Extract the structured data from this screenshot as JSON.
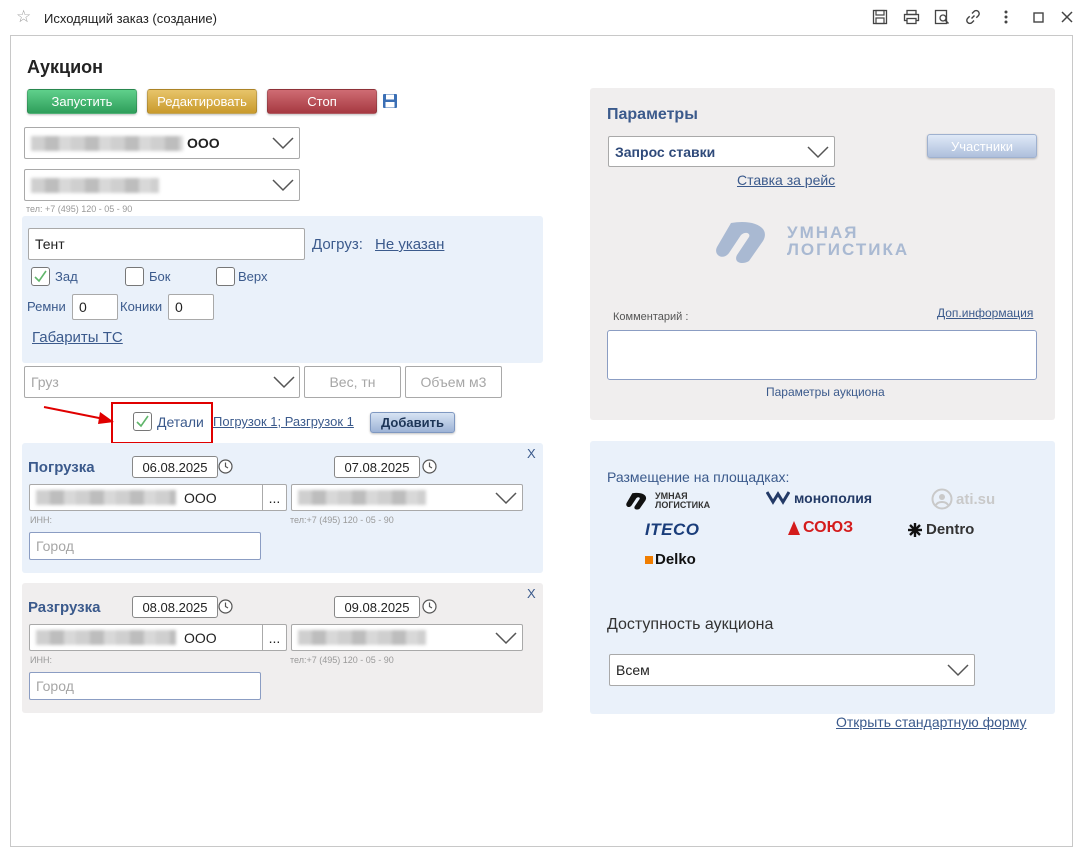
{
  "window": {
    "title": "Исходящий заказ (создание)"
  },
  "form": {
    "title": "Аукцион",
    "buttons": {
      "start": "Запустить",
      "edit": "Редактировать",
      "stop": "Стоп"
    },
    "company_suffix": "ООО",
    "contact_phone": "тел: +7 (495) 120 - 05 - 90",
    "vehicle": {
      "body_type": "Тент",
      "extra_load_label": "Догруз:",
      "extra_load_value": "Не указан",
      "load_options": [
        {
          "label": "Зад",
          "checked": true
        },
        {
          "label": "Бок",
          "checked": false
        },
        {
          "label": "Верх",
          "checked": false
        }
      ],
      "straps_label": "Ремни",
      "straps_value": "0",
      "cones_label": "Коники",
      "cones_value": "0",
      "dimensions_link": "Габариты ТС"
    },
    "cargo": {
      "placeholder": "Груз",
      "weight_placeholder": "Вес, тн",
      "volume_placeholder": "Объем м3"
    },
    "details": {
      "label": "Детали",
      "checked": true,
      "points_link": "Погрузок 1; Разгрузок 1",
      "add_button": "Добавить"
    },
    "loading": {
      "title": "Погрузка",
      "date_from": "06.08.2025",
      "date_to": "07.08.2025",
      "company_suffix": "ООО",
      "select_button": "...",
      "inn_label": "ИНН:",
      "phone": "тел:+7 (495) 120 - 05 - 90",
      "city_placeholder": "Город",
      "close": "X"
    },
    "unloading": {
      "title": "Разгрузка",
      "date_from": "08.08.2025",
      "date_to": "09.08.2025",
      "company_suffix": "ООО",
      "select_button": "...",
      "inn_label": "ИНН:",
      "phone": "тел:+7 (495) 120 - 05 - 90",
      "city_placeholder": "Город",
      "close": "X"
    }
  },
  "params": {
    "title": "Параметры",
    "rate_type": "Запрос ставки",
    "rate_link": "Ставка за рейс",
    "participants_button": "Участники",
    "logo_text_line1": "УМНАЯ",
    "logo_text_line2": "ЛОГИСТИКА",
    "comment_label": "Комментарий :",
    "extra_info_link": "Доп.информация",
    "auction_params_label": "Параметры аукциона"
  },
  "placement": {
    "title": "Размещение на площадках:",
    "platforms": [
      {
        "name": "УМНАЯ ЛОГИСТИКА",
        "active": true
      },
      {
        "name": "монополия",
        "active": true
      },
      {
        "name": "ati.su",
        "active": false
      },
      {
        "name": "ITECO",
        "active": true
      },
      {
        "name": "СОЮЗ",
        "active": true
      },
      {
        "name": "Dentro",
        "active": true
      },
      {
        "name": "Delko",
        "active": true
      }
    ],
    "availability_title": "Доступность аукциона",
    "availability_value": "Всем"
  },
  "footer": {
    "open_standard_form": "Открыть стандартную форму"
  },
  "colors": {
    "accent": "#3b5a8c",
    "panel_blue": "#eaf1fa",
    "panel_gray": "#f0eeee",
    "highlight": "#e00000"
  }
}
